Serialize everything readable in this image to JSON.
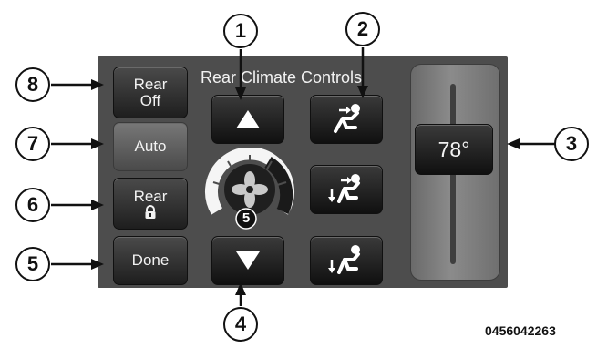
{
  "title": "Rear Climate Controls",
  "buttons": {
    "rear_off": "Rear\nOff",
    "auto": "Auto",
    "rear_lock_label": "Rear",
    "done": "Done"
  },
  "temperature": "78°",
  "fan_speed": "5",
  "callouts": [
    "1",
    "2",
    "3",
    "4",
    "5",
    "6",
    "7",
    "8"
  ],
  "image_code": "0456042263",
  "icons": [
    "up-arrow-icon",
    "down-arrow-icon",
    "face-vent-icon",
    "face-floor-vent-icon",
    "floor-vent-icon",
    "fan-icon",
    "lock-icon"
  ]
}
